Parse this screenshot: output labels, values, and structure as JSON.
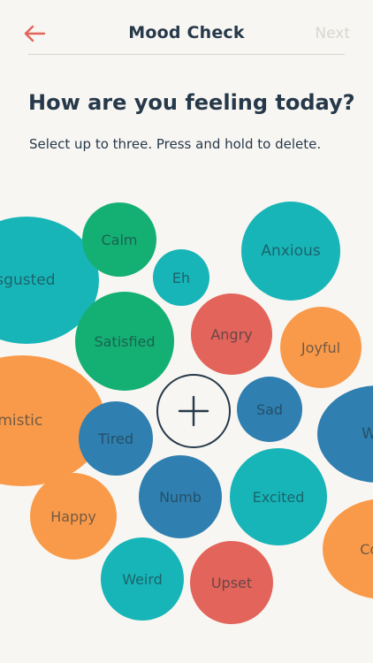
{
  "nav": {
    "title": "Mood Check",
    "next_label": "Next",
    "back_icon": "arrow-left-icon"
  },
  "heading": "How are you feeling today?",
  "subheading": "Select up to three. Press and hold to delete.",
  "add_icon": "plus-icon",
  "colors": {
    "teal": "#17b5b8",
    "green": "#14b073",
    "red": "#e2645a",
    "orange": "#f99a4a",
    "blue": "#2f7fb0",
    "accent": "#e2645a",
    "text": "#26394b"
  },
  "bubbles": [
    {
      "label": "Disgusted",
      "color": "teal"
    },
    {
      "label": "Calm",
      "color": "green"
    },
    {
      "label": "Eh",
      "color": "teal"
    },
    {
      "label": "Anxious",
      "color": "teal"
    },
    {
      "label": "Satisfied",
      "color": "green"
    },
    {
      "label": "Angry",
      "color": "red"
    },
    {
      "label": "Joyful",
      "color": "orange"
    },
    {
      "label": "Optimistic",
      "color": "orange"
    },
    {
      "label": "Sad",
      "color": "blue"
    },
    {
      "label": "Tired",
      "color": "blue"
    },
    {
      "label": "Worried",
      "color": "blue"
    },
    {
      "label": "Numb",
      "color": "blue"
    },
    {
      "label": "Excited",
      "color": "teal"
    },
    {
      "label": "Happy",
      "color": "orange"
    },
    {
      "label": "Confident",
      "color": "orange"
    },
    {
      "label": "Weird",
      "color": "teal"
    },
    {
      "label": "Upset",
      "color": "red"
    }
  ]
}
